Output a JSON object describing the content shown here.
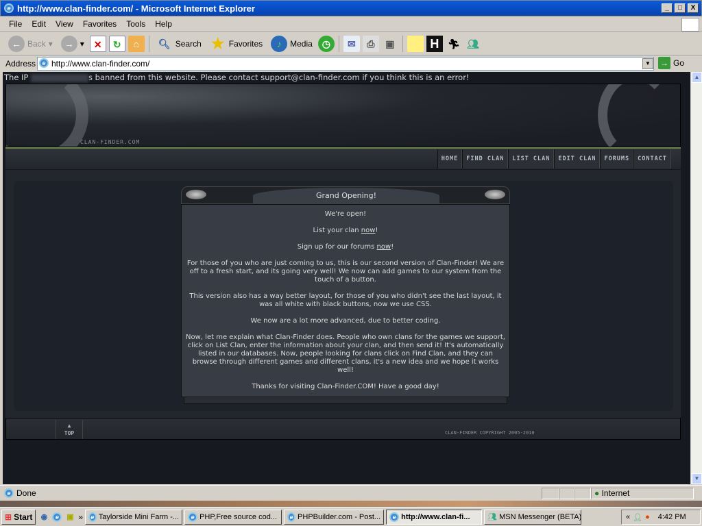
{
  "window": {
    "title": "http://www.clan-finder.com/ - Microsoft Internet Explorer",
    "minimize": "_",
    "maximize": "□",
    "close": "X"
  },
  "menu": [
    "File",
    "Edit",
    "View",
    "Favorites",
    "Tools",
    "Help"
  ],
  "toolbar": {
    "back": "Back",
    "search": "Search",
    "favorites": "Favorites",
    "media": "Media"
  },
  "address": {
    "label": "Address",
    "url": "http://www.clan-finder.com/",
    "go": "Go"
  },
  "page": {
    "ban_prefix": "The IP ",
    "ban_suffix": "s banned from this website. Please contact support@clan-finder.com if you think this is an error!",
    "logo": "CLAN-FINDER.COM",
    "nav": [
      "HOME",
      "FIND CLAN",
      "LIST CLAN",
      "EDIT CLAN",
      "FORUMS",
      "CONTACT"
    ],
    "box": {
      "title": "Grand Opening!",
      "p1": "We're open!",
      "p2_pre": "List your clan ",
      "p2_link": "now",
      "p2_post": "!",
      "p3_pre": "Sign up for our forums ",
      "p3_link": "now",
      "p3_post": "!",
      "p4": "For those of you who are just coming to us, this is our second version of Clan-Finder!  We are off to a fresh start, and its going very well!  We now can add games to our system from the touch of a button.",
      "p5": "This version also has a way better layout, for those of you who didn't see the last layout, it was all white with black buttons, now we use CSS.",
      "p6": "We now are a lot more advanced, due to better coding.",
      "p7": "Now, let me explain what Clan-Finder does.  People who own clans for the games we support, click on List Clan, enter the information about your clan, and then send it!  It's automatically listed in our databases.  Now, people looking for clans click on Find Clan, and they can browse through different games and different clans, it's a new idea and we hope it works well!",
      "p8": "Thanks for visiting Clan-Finder.COM!  Have a good day!"
    },
    "footer": {
      "top_arrow": "▲",
      "top": "TOP",
      "copyright": "CLAN-FINDER COPYRIGHT 2005-2010"
    }
  },
  "status": {
    "text": "Done",
    "zone": "Internet"
  },
  "taskbar": {
    "start": "Start",
    "more": "»",
    "tasks": [
      "Taylorside Mini Farm -...",
      "PHP,Free source cod...",
      "PHPBuilder.com - Post...",
      "http://www.clan-fi...",
      "MSN Messenger (BETA)"
    ],
    "tray_more": "«",
    "clock": "4:42 PM"
  }
}
